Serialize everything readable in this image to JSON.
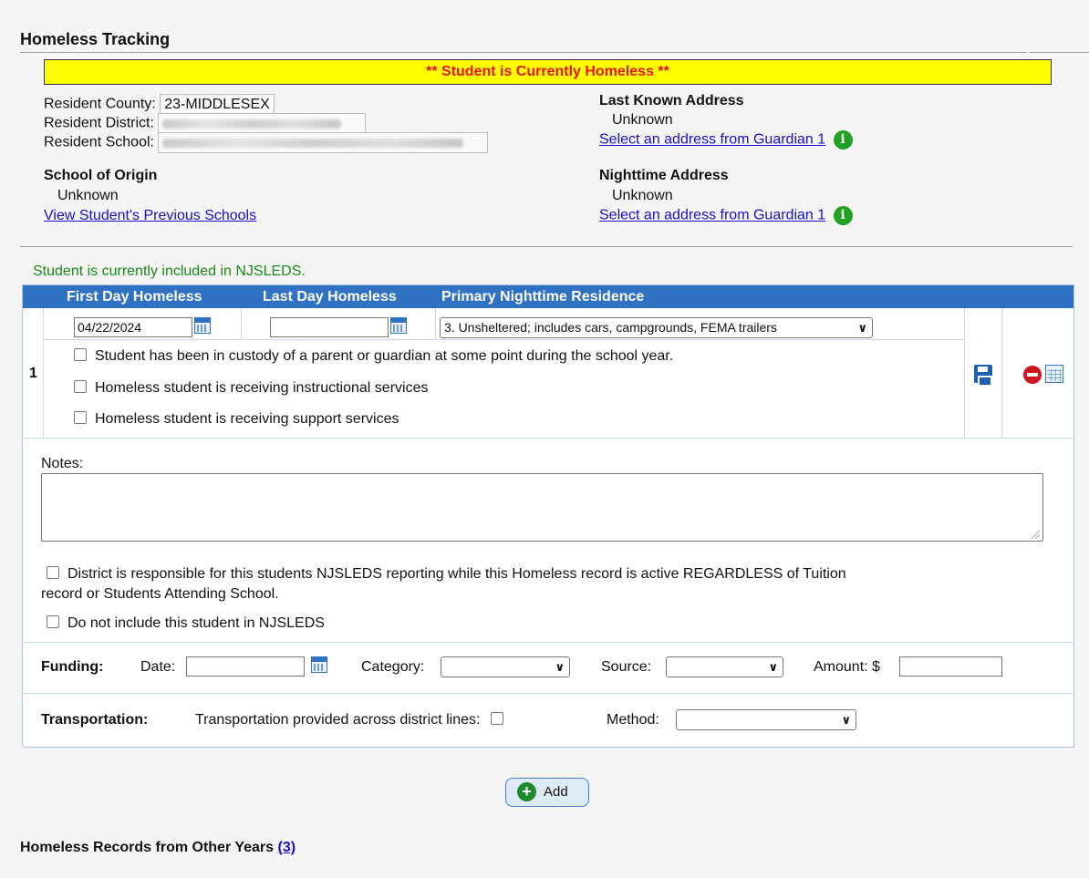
{
  "section_title": "Homeless Tracking",
  "banner": "** Student is Currently Homeless **",
  "resident": {
    "county_label": "Resident County:",
    "county_value": "23-MIDDLESEX",
    "district_label": "Resident District:",
    "school_label": "Resident School:"
  },
  "school_of_origin": {
    "heading": "School of Origin",
    "value": "Unknown",
    "link": "View Student's Previous Schools"
  },
  "last_known_address": {
    "heading": "Last Known Address",
    "value": "Unknown",
    "link": "Select an address from Guardian 1"
  },
  "nighttime_address": {
    "heading": "Nighttime Address",
    "value": "Unknown",
    "link": "Select an address from Guardian 1"
  },
  "status_message": "Student is currently included in NJSLEDS.",
  "grid": {
    "columns": [
      "First Day Homeless",
      "Last Day Homeless",
      "Primary Nighttime Residence"
    ],
    "row_number": "1",
    "first_day": "04/22/2024",
    "last_day": "",
    "residence": "3. Unsheltered; includes cars, campgrounds, FEMA trailers",
    "checkboxes": [
      "Student has been in custody of a parent or guardian at some point during the school year.",
      "Homeless student is receiving instructional services",
      "Homeless student is receiving support services"
    ],
    "notes_label": "Notes:",
    "notes_value": "",
    "district_responsible_line1": "District is responsible for this students NJSLEDS reporting while this Homeless record is active REGARDLESS of Tuition",
    "district_responsible_line2": "record or Students Attending School.",
    "exclude_label": "Do not include this student in NJSLEDS",
    "funding": {
      "label": "Funding:",
      "date_label": "Date:",
      "date_value": "",
      "category_label": "Category:",
      "category_value": "",
      "source_label": "Source:",
      "source_value": "",
      "amount_label": "Amount: $",
      "amount_value": ""
    },
    "transportation": {
      "label": "Transportation:",
      "across_lines_label": "Transportation provided across district lines:",
      "method_label": "Method:",
      "method_value": ""
    }
  },
  "add_button": "Add",
  "other_years": {
    "label": "Homeless Records from Other Years",
    "count_link": "(3)"
  },
  "colors": {
    "banner_bg": "#ffff00",
    "banner_text": "#ee1111",
    "grid_header": "#2f72c4",
    "status_green": "#1a8a1a",
    "link": "#1a0dcc"
  },
  "icons": [
    "calendar-icon",
    "info-icon",
    "save-icon",
    "delete-icon",
    "table-icon",
    "plus-icon",
    "chevron-down-icon"
  ]
}
